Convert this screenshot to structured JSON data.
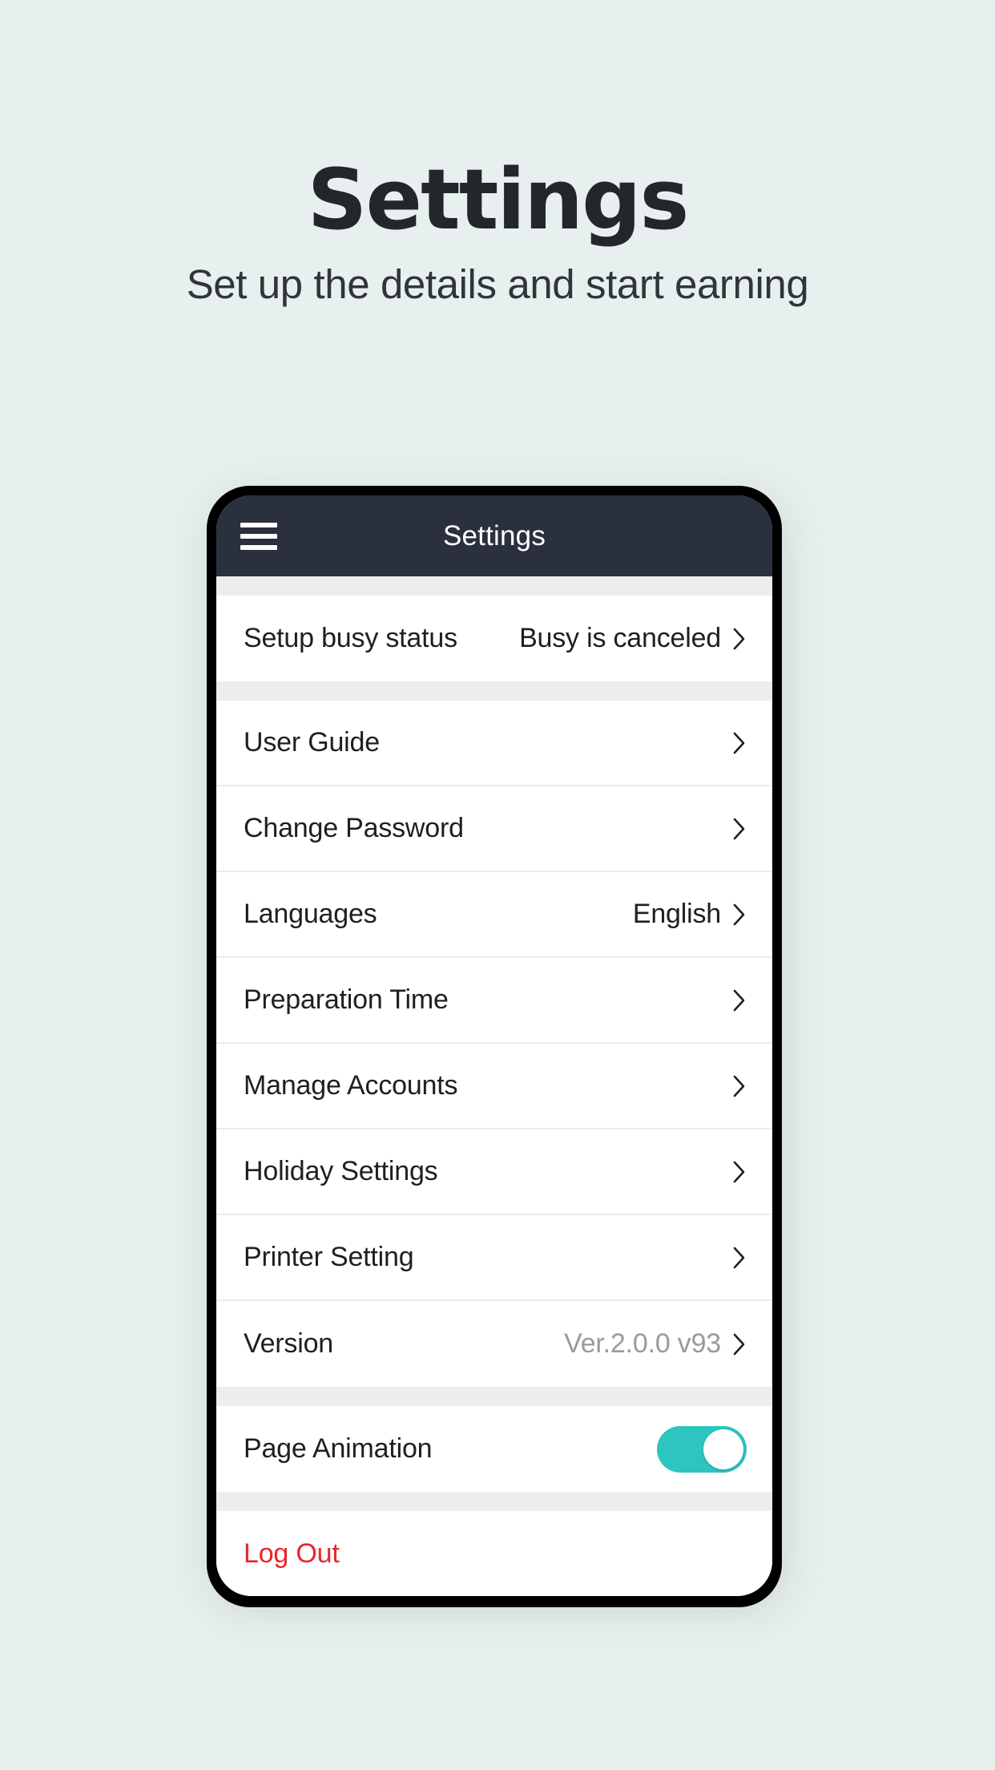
{
  "header": {
    "title": "Settings",
    "subtitle": "Set up the details and start earning"
  },
  "colors": {
    "page_background": "#e8f0ef",
    "appbar": "#2b303e",
    "toggle_on": "#2cc5c0",
    "logout_text": "#e8272c",
    "muted_text": "#9a9a9a"
  },
  "phone": {
    "appbar": {
      "menu_icon": "hamburger-menu-icon",
      "title": "Settings"
    },
    "groups": [
      {
        "rows": [
          {
            "label": "Setup busy status",
            "value": "Busy is canceled",
            "value_muted": false,
            "accessory": "chevron-right-icon"
          }
        ]
      },
      {
        "rows": [
          {
            "label": "User Guide",
            "value": "",
            "value_muted": false,
            "accessory": "chevron-right-icon"
          },
          {
            "label": "Change Password",
            "value": "",
            "value_muted": false,
            "accessory": "chevron-right-icon"
          },
          {
            "label": "Languages",
            "value": "English",
            "value_muted": false,
            "accessory": "chevron-right-icon"
          },
          {
            "label": "Preparation Time",
            "value": "",
            "value_muted": false,
            "accessory": "chevron-right-icon"
          },
          {
            "label": "Manage Accounts",
            "value": "",
            "value_muted": false,
            "accessory": "chevron-right-icon"
          },
          {
            "label": "Holiday Settings",
            "value": "",
            "value_muted": false,
            "accessory": "chevron-right-icon"
          },
          {
            "label": "Printer Setting",
            "value": "",
            "value_muted": false,
            "accessory": "chevron-right-icon"
          },
          {
            "label": "Version",
            "value": "Ver.2.0.0 v93",
            "value_muted": true,
            "accessory": "chevron-right-icon"
          }
        ]
      },
      {
        "rows": [
          {
            "label": "Page Animation",
            "value": "",
            "value_muted": false,
            "accessory": "toggle-switch",
            "toggle_on": true
          }
        ]
      },
      {
        "rows": [
          {
            "label": "Log Out",
            "value": "",
            "value_muted": false,
            "accessory": "none",
            "danger": true
          }
        ]
      }
    ]
  }
}
